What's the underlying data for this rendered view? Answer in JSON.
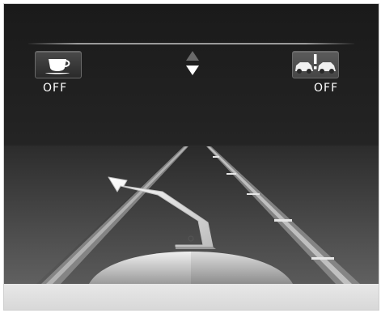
{
  "driver_assist": {
    "attention_assist": {
      "icon": "coffee-cup-icon",
      "status": "OFF"
    },
    "distance_warning": {
      "icon": "vehicle-distance-warning-icon",
      "status": "OFF"
    },
    "navigation": {
      "icon": "up-down-arrows-icon"
    }
  },
  "scene": {
    "road_icon": "lane-road-view",
    "vehicle_icon": "car-rear-view",
    "path_icon": "lane-change-arrow"
  },
  "colors": {
    "background": "#1c1c1c",
    "text": "#ffffff",
    "road": "#3a3a3a",
    "lane_line": "#d9d9d9"
  }
}
